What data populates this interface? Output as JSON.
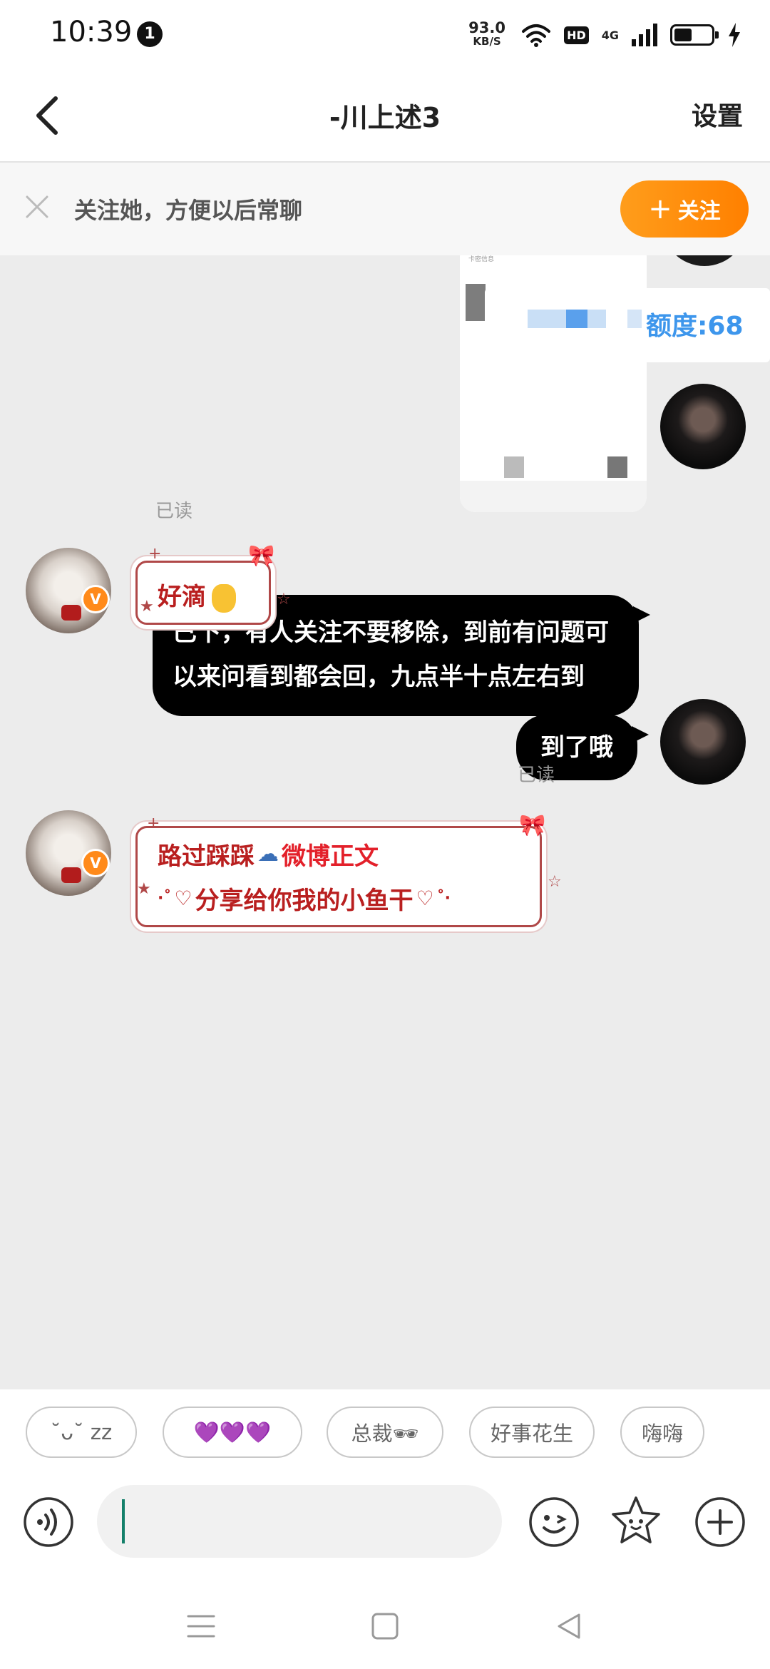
{
  "status_bar": {
    "time": "10:39",
    "notification_count": "1",
    "net_speed": "93.0",
    "net_speed_unit": "KB/S",
    "hd_label": "HD",
    "network_label": "4G"
  },
  "header": {
    "title": "-川上述3",
    "settings_label": "设置"
  },
  "follow_banner": {
    "text": "关注她，方便以后常聊",
    "button_label": "关注"
  },
  "messages": {
    "image_quota_text": "额度:68",
    "image_tiny_text": "卡密信息",
    "msg1": "已下，有人关注不要移除，到前有问题可以来问看到都会回，九点半十点左右到",
    "msg1_status": "已读",
    "reply1_text": "好滴",
    "msg2": "到了哦",
    "msg2_status": "已读",
    "card_line1_a": "路过踩踩",
    "card_line1_b": "微博正文",
    "card_line2": "分享给你我的小鱼干",
    "verified_badge": "V"
  },
  "quick_replies": [
    "˘ᴗ˘ zz",
    "💜💜💜",
    "总裁🕶",
    "好事花生",
    "嗨嗨"
  ],
  "input": {
    "value": ""
  },
  "colors": {
    "accent": "#ff8a1a",
    "bubble_dark": "#000000",
    "card_red": "#b91f1f",
    "quota_blue": "#3d96ec"
  },
  "icons": {
    "back": "chevron-left-icon",
    "close": "close-icon",
    "voice": "voice-icon",
    "emoji": "emoji-icon",
    "sticker": "star-face-icon",
    "more": "plus-circle-icon"
  }
}
